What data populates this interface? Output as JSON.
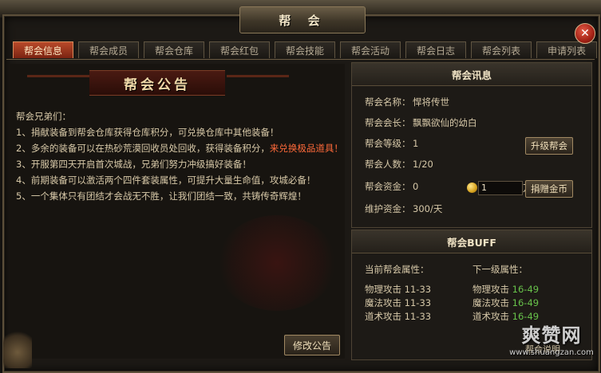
{
  "window": {
    "title": "帮 会",
    "close_icon": "close-icon"
  },
  "tabs": [
    {
      "label": "帮会信息",
      "active": true
    },
    {
      "label": "帮会成员"
    },
    {
      "label": "帮会仓库"
    },
    {
      "label": "帮会红包"
    },
    {
      "label": "帮会技能"
    },
    {
      "label": "帮会活动"
    },
    {
      "label": "帮会日志"
    },
    {
      "label": "帮会列表"
    },
    {
      "label": "申请列表"
    }
  ],
  "notice": {
    "title": "帮会公告",
    "greeting": "帮会兄弟们：",
    "lines": [
      "1、捐献装备到帮会仓库获得仓库积分，可兑换仓库中其他装备！",
      "2、多余的装备可以在热砂荒漠回收员处回收，获得装备积分，",
      "来兑换极品道具！",
      "3、开服第四天开启首次城战，兄弟们努力冲级搞好装备！",
      "4、前期装备可以激活两个四件套装属性，可提升大量生命值，攻城必备！",
      "5、一个集体只有团结才会战无不胜，让我们团结一致，共铸传奇辉煌！"
    ],
    "edit_button": "修改公告"
  },
  "guild_info": {
    "header": "帮会讯息",
    "name_label": "帮会名称：",
    "name_value": "悍将传世",
    "leader_label": "帮会会长：",
    "leader_value": "飘飘欲仙的幼白",
    "level_label": "帮会等级：",
    "level_value": "1",
    "upgrade_button": "升级帮会",
    "members_label": "帮会人数：",
    "members_value": "1/20",
    "funds_label": "帮会资金：",
    "funds_value": "0",
    "donate_amount": "1",
    "donate_unit": "万",
    "donate_button": "捐赠金币",
    "upkeep_label": "维护资金：",
    "upkeep_value": "300/天"
  },
  "buff": {
    "header": "帮会BUFF",
    "current_header": "当前帮会属性：",
    "next_header": "下一级属性：",
    "current": [
      {
        "name": "物理攻击",
        "value": "11-33"
      },
      {
        "name": "魔法攻击",
        "value": "11-33"
      },
      {
        "name": "道术攻击",
        "value": "11-33"
      }
    ],
    "next": [
      {
        "name": "物理攻击",
        "value": "16-49"
      },
      {
        "name": "魔法攻击",
        "value": "16-49"
      },
      {
        "name": "道术攻击",
        "value": "16-49"
      }
    ],
    "partially_hidden_text": "帮会说明"
  },
  "watermark": {
    "site_name": "爽赞网",
    "site_url": "www.shuangzan.com"
  },
  "colors": {
    "active_tab": "#b94a2a",
    "highlight_text": "#ff6a3a",
    "buff_next_value": "#67c14a"
  }
}
